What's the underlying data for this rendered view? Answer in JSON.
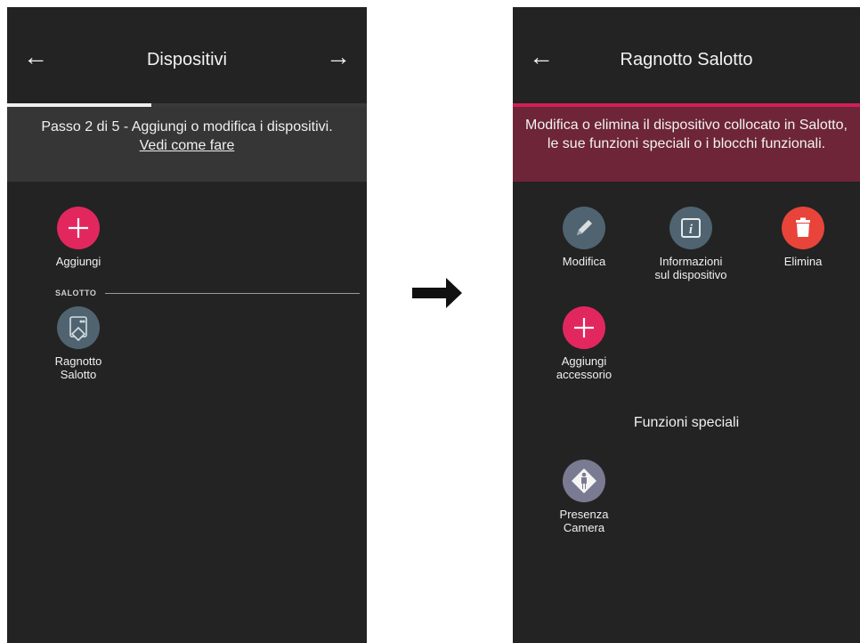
{
  "left": {
    "title": "Dispositivi",
    "back_icon": "arrow-left-icon",
    "next_icon": "arrow-right-icon",
    "progress": 0.4,
    "step_text": "Passo 2 di 5 - Aggiungi o modifica i dispositivi.",
    "help_link": "Vedi come fare",
    "add_label": "Aggiungi",
    "section": "SALOTTO",
    "device_label_1": "Ragnotto",
    "device_label_2": "Salotto"
  },
  "flow_arrow_icon": "right-arrow-icon",
  "right": {
    "title": "Ragnotto Salotto",
    "back_icon": "arrow-left-icon",
    "info_text": "Modifica o elimina il dispositivo collocato in Salotto, le sue funzioni speciali o i blocchi funzionali.",
    "actions": [
      {
        "label_1": "Modifica",
        "label_2": "",
        "icon": "pencil-icon"
      },
      {
        "label_1": "Informazioni",
        "label_2": "sul dispositivo",
        "icon": "info-icon"
      },
      {
        "label_1": "Elimina",
        "label_2": "",
        "icon": "trash-icon"
      }
    ],
    "add_accessory_1": "Aggiungi",
    "add_accessory_2": "accessorio",
    "special_functions_title": "Funzioni speciali",
    "presence_1": "Presenza",
    "presence_2": "Camera"
  },
  "colors": {
    "accent_pink": "#e2275f",
    "delete_red": "#e8443a",
    "info_band_right": "#6e2537",
    "screen_bg": "#232323"
  }
}
